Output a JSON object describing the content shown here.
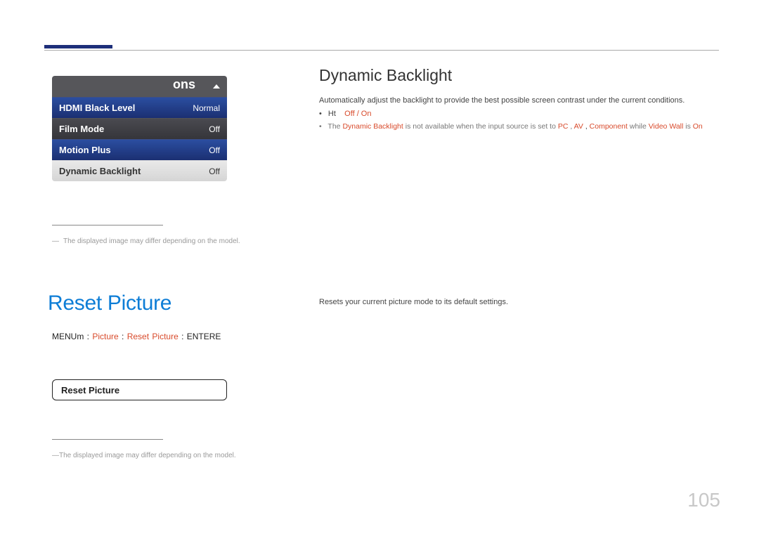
{
  "menu": {
    "header_partial": "ons",
    "rows": {
      "hdmi": {
        "label": "HDMI Black Level",
        "value": "Normal"
      },
      "film": {
        "label": "Film Mode",
        "value": "Off"
      },
      "motion": {
        "label": "Motion Plus",
        "value": "Off"
      },
      "dynbl": {
        "label": "Dynamic Backlight",
        "value": "Off"
      }
    }
  },
  "note_text": "The displayed image may differ depending on the model.",
  "right": {
    "heading": "Dynamic Backlight",
    "desc": "Automatically adjust the backlight to provide the best possible screen contrast under the current conditions.",
    "opt_prefix": "Ht",
    "opt_values": "Off / On",
    "note_prefix": "The ",
    "note_hl1": "Dynamic Backlight",
    "note_mid1": " is not available when the input source is set to ",
    "note_hl2": "PC",
    "note_sep1": ", ",
    "note_hl3": "AV",
    "note_sep2": ", ",
    "note_hl4": "Component",
    "note_mid2": " while ",
    "note_hl5": "Video Wall",
    "note_mid3": " is ",
    "note_hl6": "On"
  },
  "reset": {
    "title": "Reset Picture",
    "path_menu": "MENUm",
    "path_arrow": " : ",
    "path_picture": "Picture",
    "path_reset": "Reset Picture",
    "path_enter": "ENTERE",
    "button_label": "Reset Picture",
    "desc": "Resets your current picture mode to its default settings."
  },
  "page_number": "105"
}
